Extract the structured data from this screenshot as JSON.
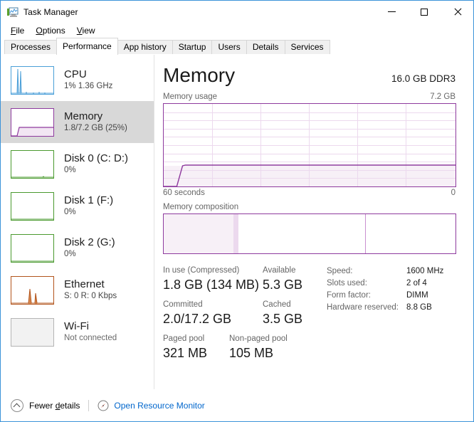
{
  "window": {
    "title": "Task Manager",
    "icon": "task-manager-icon",
    "controls": {
      "minimize": "Minimize",
      "maximize": "Maximize",
      "close": "Close"
    }
  },
  "menubar": {
    "items": [
      {
        "label": "File",
        "accel": "F"
      },
      {
        "label": "Options",
        "accel": "O"
      },
      {
        "label": "View",
        "accel": "V"
      }
    ]
  },
  "tabs": [
    {
      "label": "Processes",
      "active": false
    },
    {
      "label": "Performance",
      "active": true
    },
    {
      "label": "App history",
      "active": false
    },
    {
      "label": "Startup",
      "active": false
    },
    {
      "label": "Users",
      "active": false
    },
    {
      "label": "Details",
      "active": false
    },
    {
      "label": "Services",
      "active": false
    }
  ],
  "sidebar": {
    "items": [
      {
        "title": "CPU",
        "sub": "1%  1.36 GHz",
        "color": "#4a9fd8",
        "selected": false
      },
      {
        "title": "Memory",
        "sub": "1.8/7.2 GB (25%)",
        "color": "#8e3a9e",
        "selected": true
      },
      {
        "title": "Disk 0 (C: D:)",
        "sub": "0%",
        "color": "#4a9a2f",
        "selected": false
      },
      {
        "title": "Disk 1 (F:)",
        "sub": "0%",
        "color": "#4a9a2f",
        "selected": false
      },
      {
        "title": "Disk 2 (G:)",
        "sub": "0%",
        "color": "#4a9a2f",
        "selected": false
      },
      {
        "title": "Ethernet",
        "sub": "S: 0 R: 0 Kbps",
        "color": "#b2541c",
        "selected": false
      },
      {
        "title": "Wi-Fi",
        "sub": "Not connected",
        "color": "#b4b4b4",
        "selected": false
      }
    ]
  },
  "main": {
    "title": "Memory",
    "spec_summary": "16.0 GB DDR3",
    "graph": {
      "label": "Memory usage",
      "max_label": "7.2 GB",
      "x_left_label": "60 seconds",
      "x_right_label": "0",
      "accent": "#8e3a9e",
      "fill": "#f7f0f7"
    },
    "composition": {
      "label": "Memory composition",
      "in_use_pct": 24,
      "divider_pct": 69
    },
    "stats": {
      "rows": [
        [
          {
            "label": "In use (Compressed)",
            "value": "1.8 GB (134 MB)",
            "width": 140
          },
          {
            "label": "Available",
            "value": "5.3 GB",
            "width": 80
          }
        ],
        [
          {
            "label": "Committed",
            "value": "2.0/17.2 GB",
            "width": 140
          },
          {
            "label": "Cached",
            "value": "3.5 GB",
            "width": 80
          }
        ],
        [
          {
            "label": "Paged pool",
            "value": "321 MB",
            "width": 93
          },
          {
            "label": "Non-paged pool",
            "value": "105 MB",
            "width": 90
          }
        ]
      ]
    },
    "specs": [
      {
        "key": "Speed:",
        "value": "1600 MHz"
      },
      {
        "key": "Slots used:",
        "value": "2 of 4"
      },
      {
        "key": "Form factor:",
        "value": "DIMM"
      },
      {
        "key": "Hardware reserved:",
        "value": "8.8 GB"
      }
    ]
  },
  "footer": {
    "fewer_details": "Fewer details",
    "fewer_details_accel": "d",
    "resource_monitor": "Open Resource Monitor",
    "link_color": "#0066cc"
  }
}
